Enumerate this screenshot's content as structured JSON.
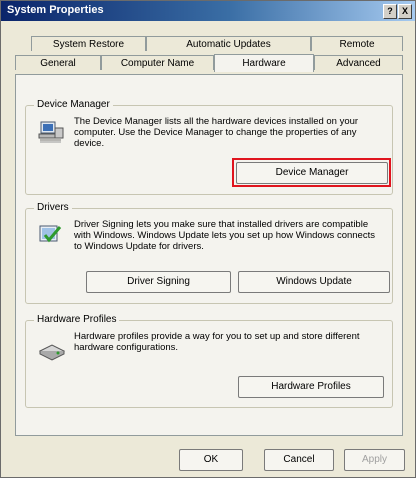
{
  "window": {
    "title": "System Properties",
    "help_label": "?",
    "close_label": "X"
  },
  "tabs_back": [
    "System Restore",
    "Automatic Updates",
    "Remote"
  ],
  "tabs_front": [
    "General",
    "Computer Name",
    "Hardware",
    "Advanced"
  ],
  "selected_tab": "Hardware",
  "device_manager": {
    "title": "Device Manager",
    "description": "The Device Manager lists all the hardware devices installed on your computer. Use the Device Manager to change the properties of any device.",
    "button": "Device Manager"
  },
  "drivers": {
    "title": "Drivers",
    "description": "Driver Signing lets you make sure that installed drivers are compatible with Windows. Windows Update lets you set up how Windows connects to Windows Update for drivers.",
    "signing_button": "Driver Signing",
    "update_button": "Windows Update"
  },
  "hardware_profiles": {
    "title": "Hardware Profiles",
    "description": "Hardware profiles provide a way for you to set up and store different hardware configurations.",
    "button": "Hardware Profiles"
  },
  "footer": {
    "ok": "OK",
    "cancel": "Cancel",
    "apply": "Apply"
  },
  "highlight_color": "#e0141e"
}
